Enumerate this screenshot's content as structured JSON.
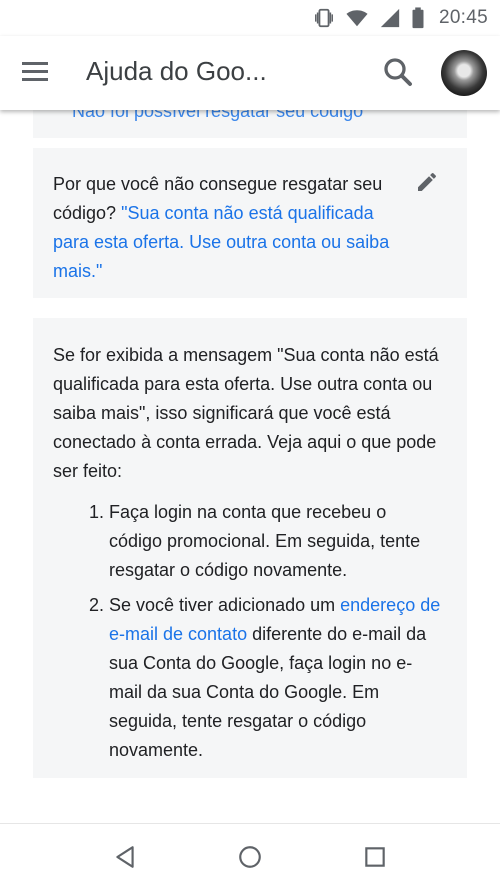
{
  "status_bar": {
    "time": "20:45",
    "icons": [
      "vibrate-icon",
      "wifi-icon",
      "signal-icon",
      "battery-icon"
    ]
  },
  "app_bar": {
    "title": "Ajuda do Goo...",
    "icons": [
      "menu-icon",
      "search-icon",
      "avatar"
    ]
  },
  "previous_item": {
    "link_text": "Não foi possível resgatar seu código"
  },
  "question_card": {
    "question_text": "Por que você não consegue resgatar seu código?",
    "answer_link": "\"Sua conta não está qualificada para esta oferta. Use outra conta ou saiba mais.\"",
    "edit_icon": "pencil-icon"
  },
  "answer_card": {
    "intro": "Se for exibida a mensagem \"Sua conta não está qualificada para esta oferta. Use outra conta ou saiba mais\", isso significará que você está conectado à conta errada. Veja aqui o que pode ser feito:",
    "step1": "Faça login na conta que recebeu o código promocional. Em seguida, tente resgatar o código novamente.",
    "step2_before": "Se você tiver adicionado um ",
    "step2_link": "endereço de e-mail de contato",
    "step2_after": " diferente do e-mail da sua Conta do Google, faça login no e-mail da sua Conta do Google. Em seguida, tente resgatar o código novamente."
  },
  "nav_bar": {
    "icons": [
      "back-icon",
      "home-icon",
      "recents-icon"
    ]
  },
  "colors": {
    "link": "#1a73e8",
    "card_background": "#f5f6f7",
    "text": "#202124",
    "icon": "#5f6368"
  }
}
